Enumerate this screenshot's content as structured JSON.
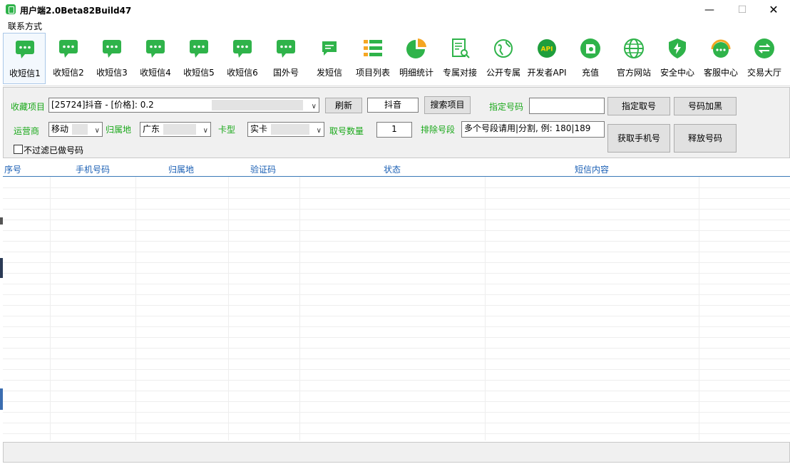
{
  "window": {
    "title": "用户端2.0Beta82Build47",
    "minimize": "—",
    "maximize": "☐",
    "close": "✕"
  },
  "menu": {
    "items": [
      "联系方式"
    ]
  },
  "toolbar": {
    "items": [
      {
        "label": "收短信1",
        "icon": "chat-bubble-icon"
      },
      {
        "label": "收短信2",
        "icon": "chat-bubble-icon"
      },
      {
        "label": "收短信3",
        "icon": "chat-bubble-icon"
      },
      {
        "label": "收短信4",
        "icon": "chat-bubble-icon"
      },
      {
        "label": "收短信5",
        "icon": "chat-bubble-icon"
      },
      {
        "label": "收短信6",
        "icon": "chat-bubble-icon"
      },
      {
        "label": "国外号",
        "icon": "chat-bubble-icon"
      },
      {
        "label": "发短信",
        "icon": "message-square-icon"
      },
      {
        "label": "项目列表",
        "icon": "list-icon"
      },
      {
        "label": "明细统计",
        "icon": "pie-chart-icon"
      },
      {
        "label": "专属对接",
        "icon": "document-search-icon"
      },
      {
        "label": "公开专属",
        "icon": "globe-outline-icon"
      },
      {
        "label": "开发者API",
        "icon": "api-icon"
      },
      {
        "label": "充值",
        "icon": "wallet-icon"
      },
      {
        "label": "官方网站",
        "icon": "globe-icon"
      },
      {
        "label": "安全中心",
        "icon": "shield-icon"
      },
      {
        "label": "客服中心",
        "icon": "headset-icon"
      },
      {
        "label": "交易大厅",
        "icon": "exchange-icon"
      }
    ],
    "api_badge": "API",
    "colors": {
      "green": "#2fb34a",
      "orange": "#f5a623"
    }
  },
  "form": {
    "fav_label": "收藏项目",
    "fav_value": "[25724]抖音 - [价格]: 0.2",
    "refresh": "刷新",
    "search_value": "抖音",
    "search_button": "搜索项目",
    "assign_label": "指定号码",
    "assign_value": "",
    "assign_button": "指定取号",
    "blacklist_button": "号码加黑",
    "carrier_label": "运营商",
    "carrier_value": "移动",
    "region_label": "归属地",
    "region_value": "广东",
    "cardtype_label": "卡型",
    "cardtype_value": "实卡",
    "count_label": "取号数量",
    "count_value": "1",
    "exclude_label": "排除号段",
    "exclude_value": "多个号段请用|分割, 例: 180|189",
    "get_button": "获取手机号",
    "release_button": "释放号码",
    "no_filter_label": "不过滤已做号码",
    "dropdown_arrow": "∨"
  },
  "table": {
    "headers": [
      "序号",
      "手机号码",
      "归属地",
      "验证码",
      "状态",
      "短信内容"
    ],
    "rows": []
  }
}
